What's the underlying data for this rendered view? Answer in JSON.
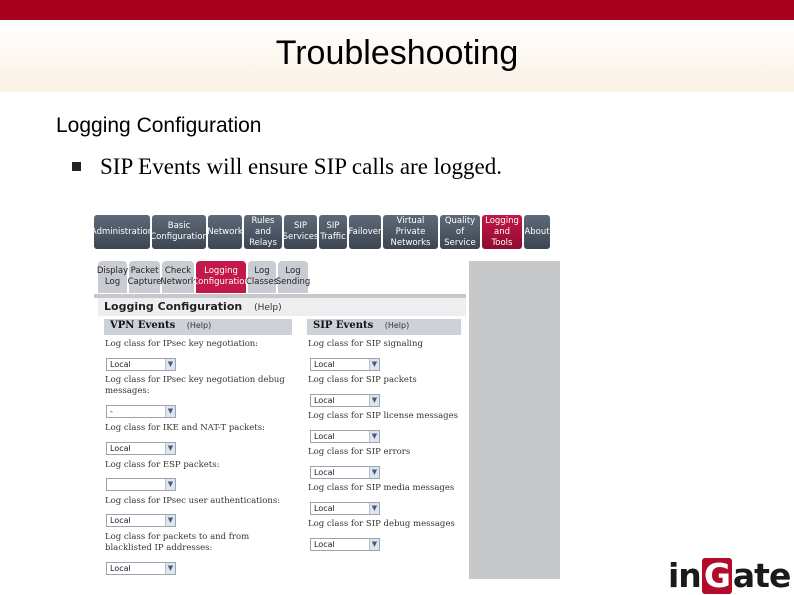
{
  "slide": {
    "title": "Troubleshooting",
    "subtitle": "Logging Configuration",
    "bullet": "SIP Events will ensure SIP calls are logged."
  },
  "screenshot": {
    "main_nav": [
      {
        "label": "Administration",
        "active": false
      },
      {
        "label": "Basic Configuration",
        "active": false
      },
      {
        "label": "Network",
        "active": false
      },
      {
        "label": "Rules and Relays",
        "active": false
      },
      {
        "label": "SIP Services",
        "active": false
      },
      {
        "label": "SIP Traffic",
        "active": false
      },
      {
        "label": "Failover",
        "active": false
      },
      {
        "label": "Virtual Private Networks",
        "active": false
      },
      {
        "label": "Quality of Service",
        "active": false
      },
      {
        "label": "Logging and Tools",
        "active": true
      },
      {
        "label": "About",
        "active": false
      }
    ],
    "sub_tabs": [
      {
        "label": "Display Log",
        "active": false
      },
      {
        "label": "Packet Capture",
        "active": false
      },
      {
        "label": "Check Network",
        "active": false
      },
      {
        "label": "Logging Configuration",
        "active": true
      },
      {
        "label": "Log Classes",
        "active": false
      },
      {
        "label": "Log Sending",
        "active": false
      }
    ],
    "section_title": "Logging Configuration",
    "help_label": "(Help)",
    "vpn": {
      "title": "VPN Events",
      "fields": [
        {
          "label": "Log class for IPsec key negotiation:",
          "value": "Local"
        },
        {
          "label": "Log class for IPsec key negotiation debug messages:",
          "value": "-"
        },
        {
          "label": "Log class for IKE and NAT-T packets:",
          "value": "Local"
        },
        {
          "label": "Log class for ESP packets:",
          "value": ""
        },
        {
          "label": "Log class for IPsec user authentications:",
          "value": "Local"
        },
        {
          "label": "Log class for packets to and from blacklisted IP addresses:",
          "value": "Local"
        }
      ]
    },
    "sip": {
      "title": "SIP Events",
      "fields": [
        {
          "label": "Log class for SIP signaling",
          "value": "Local"
        },
        {
          "label": "Log class for SIP packets",
          "value": "Local"
        },
        {
          "label": "Log class for SIP license messages",
          "value": "Local"
        },
        {
          "label": "Log class for SIP errors",
          "value": "Local"
        },
        {
          "label": "Log class for SIP media messages",
          "value": "Local"
        },
        {
          "label": "Log class for SIP debug messages",
          "value": "Local"
        }
      ]
    }
  },
  "logo": {
    "prefix": "in",
    "mark": "G",
    "suffix": "ate"
  },
  "colors": {
    "brand": "#a6001e",
    "active_tab": "#c3194a"
  }
}
